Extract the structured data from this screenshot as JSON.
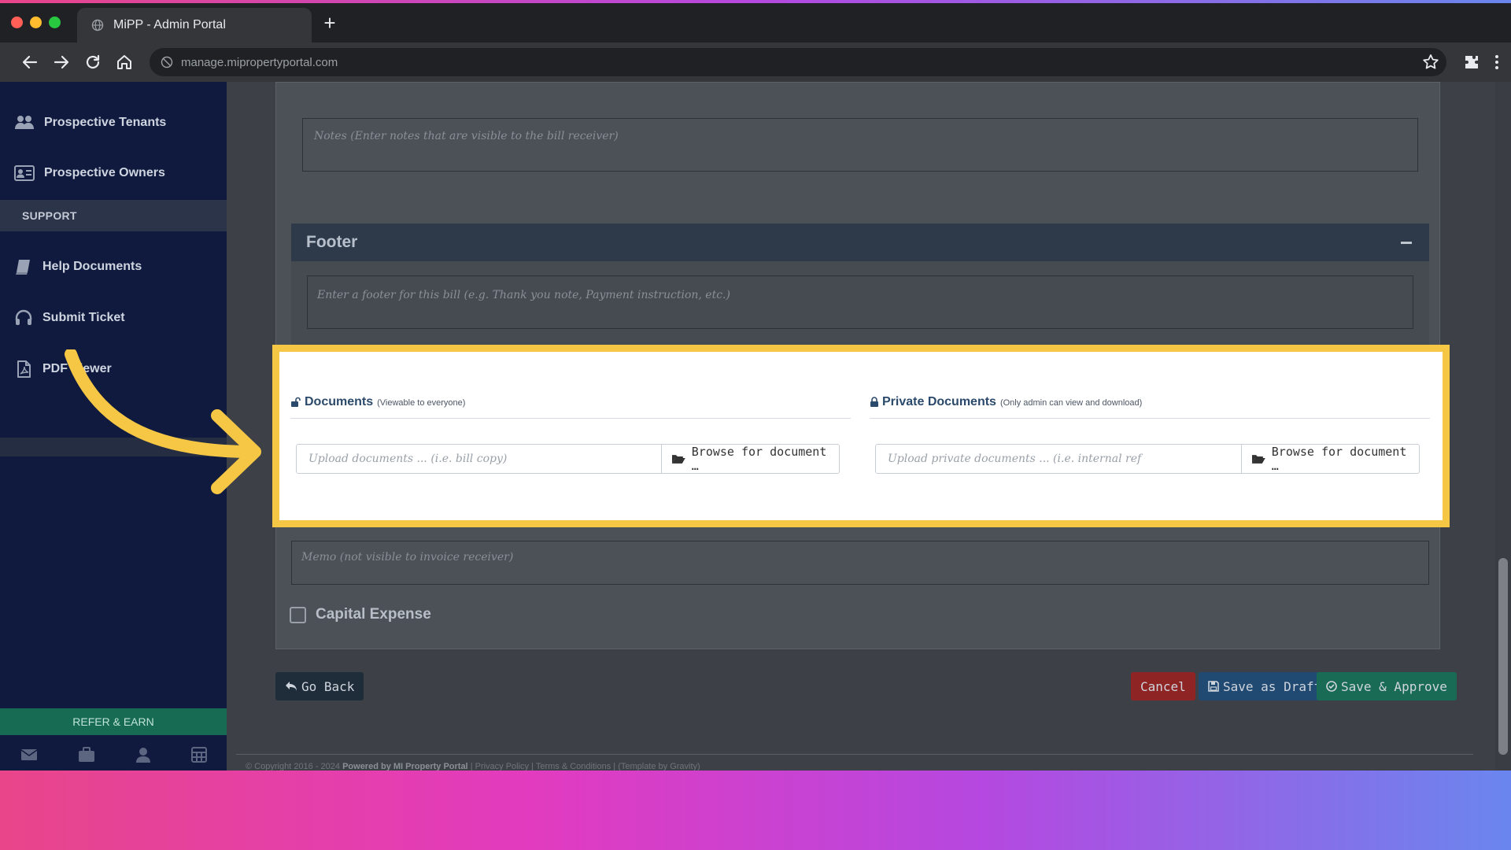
{
  "browser": {
    "tab_title": "MiPP - Admin Portal",
    "url": "manage.mipropertyportal.com"
  },
  "sidebar": {
    "items": [
      {
        "label": "Prospective Tenants",
        "icon": "users-icon"
      },
      {
        "label": "Prospective Owners",
        "icon": "id-card-icon"
      }
    ],
    "support_header": "SUPPORT",
    "support_items": [
      {
        "label": "Help Documents",
        "icon": "book-icon"
      },
      {
        "label": "Submit Ticket",
        "icon": "headset-icon"
      },
      {
        "label": "PDF Viewer",
        "icon": "pdf-file-icon"
      }
    ],
    "refer_label": "REFER & EARN"
  },
  "form": {
    "notes_placeholder": "Notes (Enter notes that are visible to the bill receiver)",
    "footer_title": "Footer",
    "footer_placeholder": "Enter a footer for this bill (e.g. Thank you note, Payment instruction, etc.)",
    "documents": {
      "title": "Documents",
      "subtitle": "(Viewable to everyone)",
      "placeholder": "Upload documents ... (i.e. bill copy)",
      "browse_label": "Browse for document …"
    },
    "private_documents": {
      "title": "Private Documents",
      "subtitle": "(Only admin can view and download)",
      "placeholder": "Upload private documents ... (i.e. internal ref",
      "browse_label": "Browse for document …"
    },
    "memo_placeholder": "Memo (not visible to invoice receiver)",
    "capital_expense_label": "Capital Expense",
    "capital_expense_checked": false
  },
  "actions": {
    "go_back": "Go Back",
    "cancel": "Cancel",
    "save_draft": "Save as Draft",
    "save_approve": "Save & Approve"
  },
  "footer": {
    "copyright": "© Copyright 2016 - 2024",
    "powered": "Powered by MI Property Portal",
    "links": "| Privacy Policy | Terms & Conditions |",
    "small": "(Template by Gravity)"
  },
  "colors": {
    "highlight_border": "#f6c744",
    "cancel": "#8f2424",
    "draft": "#214a72",
    "approve": "#1a6b55"
  }
}
